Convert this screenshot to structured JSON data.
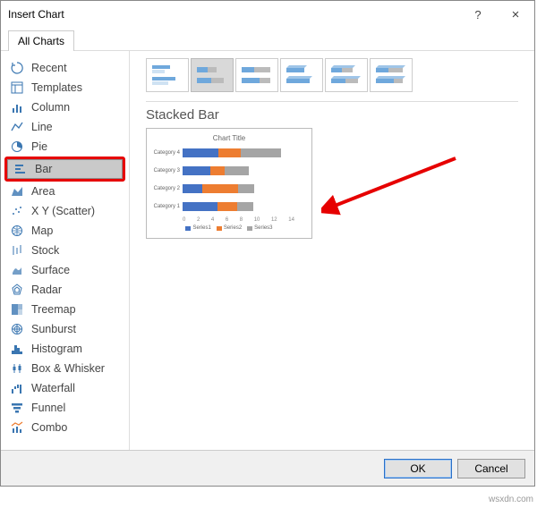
{
  "window": {
    "title": "Insert Chart",
    "help_tip": "?",
    "close_tip": "×"
  },
  "tabs": {
    "all_charts": "All Charts"
  },
  "sidebar": {
    "items": [
      {
        "label": "Recent",
        "icon": "recent"
      },
      {
        "label": "Templates",
        "icon": "templates"
      },
      {
        "label": "Column",
        "icon": "column"
      },
      {
        "label": "Line",
        "icon": "line"
      },
      {
        "label": "Pie",
        "icon": "pie"
      },
      {
        "label": "Bar",
        "icon": "bar",
        "selected": true,
        "highlighted": true
      },
      {
        "label": "Area",
        "icon": "area"
      },
      {
        "label": "X Y (Scatter)",
        "icon": "scatter"
      },
      {
        "label": "Map",
        "icon": "map"
      },
      {
        "label": "Stock",
        "icon": "stock"
      },
      {
        "label": "Surface",
        "icon": "surface"
      },
      {
        "label": "Radar",
        "icon": "radar"
      },
      {
        "label": "Treemap",
        "icon": "treemap"
      },
      {
        "label": "Sunburst",
        "icon": "sunburst"
      },
      {
        "label": "Histogram",
        "icon": "histogram"
      },
      {
        "label": "Box & Whisker",
        "icon": "box"
      },
      {
        "label": "Waterfall",
        "icon": "waterfall"
      },
      {
        "label": "Funnel",
        "icon": "funnel"
      },
      {
        "label": "Combo",
        "icon": "combo"
      }
    ]
  },
  "subtypes": {
    "items": [
      "clustered-bar",
      "stacked-bar",
      "100-stacked-bar",
      "3d-clustered-bar",
      "3d-stacked-bar",
      "3d-100-stacked-bar"
    ],
    "selected_index": 1
  },
  "preview": {
    "title": "Stacked Bar",
    "chart_title": "Chart Title",
    "legend": [
      "Series1",
      "Series2",
      "Series3"
    ]
  },
  "chart_data": {
    "type": "bar",
    "stacked": true,
    "orientation": "horizontal",
    "title": "Chart Title",
    "categories": [
      "Category 4",
      "Category 3",
      "Category 2",
      "Category 1"
    ],
    "series": [
      {
        "name": "Series1",
        "color": "#4472c4",
        "values": [
          4.5,
          3.5,
          2.5,
          4.3
        ]
      },
      {
        "name": "Series2",
        "color": "#ed7d31",
        "values": [
          2.8,
          1.8,
          4.4,
          2.4
        ]
      },
      {
        "name": "Series3",
        "color": "#a5a5a5",
        "values": [
          5.0,
          3.0,
          2.0,
          2.0
        ]
      }
    ],
    "xlabel": "",
    "ylabel": "",
    "xlim": [
      0,
      14
    ],
    "xticks": [
      0,
      2,
      4,
      6,
      8,
      10,
      12,
      14
    ]
  },
  "footer": {
    "ok": "OK",
    "cancel": "Cancel"
  },
  "watermark": "wsxdn.com"
}
